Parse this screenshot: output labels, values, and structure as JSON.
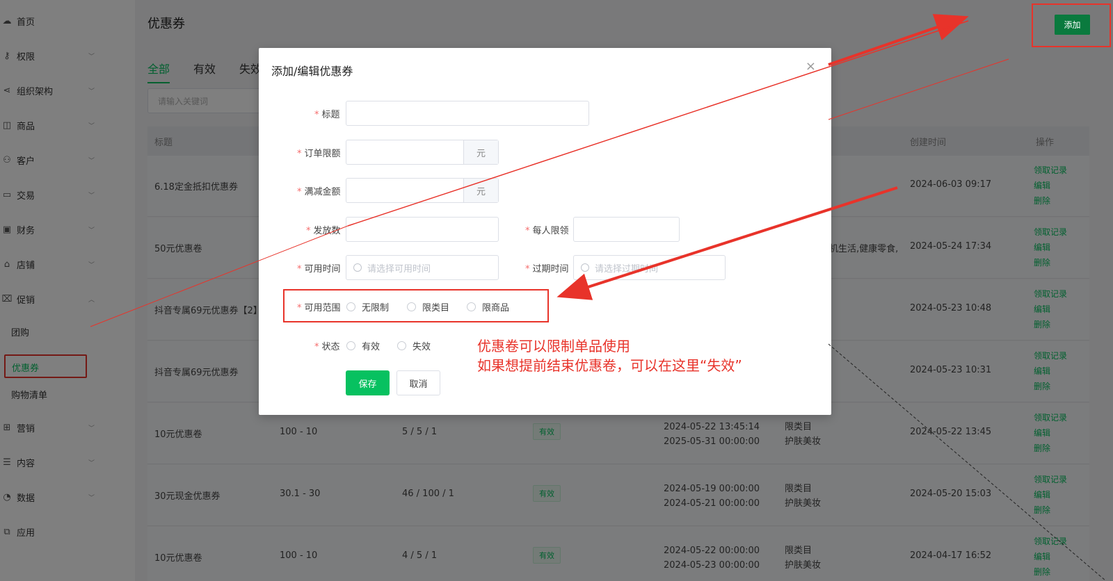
{
  "sidebar": {
    "items": [
      {
        "label": "首页",
        "icon": "cloud-icon",
        "chevron": false
      },
      {
        "label": "权限",
        "icon": "key-icon",
        "chevron": true
      },
      {
        "label": "组织架构",
        "icon": "share-icon",
        "chevron": true
      },
      {
        "label": "商品",
        "icon": "bag-icon",
        "chevron": true
      },
      {
        "label": "客户",
        "icon": "user-icon",
        "chevron": true
      },
      {
        "label": "交易",
        "icon": "folder-icon",
        "chevron": true
      },
      {
        "label": "财务",
        "icon": "wallet-icon",
        "chevron": true
      },
      {
        "label": "店铺",
        "icon": "store-icon",
        "chevron": true
      },
      {
        "label": "促销",
        "icon": "tag-icon",
        "chevron": true
      }
    ],
    "promo_sub": [
      "团购",
      "优惠券",
      "购物清单"
    ],
    "items_bottom": [
      {
        "label": "营销",
        "icon": "gift-icon"
      },
      {
        "label": "内容",
        "icon": "doc-icon"
      },
      {
        "label": "数据",
        "icon": "pie-icon"
      },
      {
        "label": "应用",
        "icon": "app-icon"
      }
    ]
  },
  "page": {
    "title": "优惠券",
    "add_label": "添加",
    "tabs": [
      "全部",
      "有效",
      "失效"
    ],
    "search_placeholder": "请输入关键词"
  },
  "table": {
    "headers": {
      "title": "标题",
      "created": "创建时间",
      "ops": "操作"
    },
    "rows": [
      {
        "title": "6.18定金抵扣优惠券",
        "cond": "",
        "count": "",
        "status": "",
        "time1": "",
        "time2": "",
        "scope1": "",
        "scope2": "",
        "created": "2024-06-03 09:17"
      },
      {
        "title": "50元优惠卷",
        "cond": "",
        "count": "",
        "status": "",
        "time1": "",
        "time2": "",
        "scope1": "机生活,健康零食,",
        "scope2": "",
        "created": "2024-05-24 17:34"
      },
      {
        "title": "抖音专属69元优惠券【2】",
        "cond": "",
        "count": "",
        "status": "",
        "time1": "",
        "time2": "",
        "scope1": "",
        "scope2": "",
        "created": "2024-05-23 10:48"
      },
      {
        "title": "抖音专属69元优惠券",
        "cond": "",
        "count": "",
        "status": "",
        "time1": "",
        "time2": "",
        "scope1": "",
        "scope2": "",
        "created": "2024-05-23 10:31"
      },
      {
        "title": "10元优惠卷",
        "cond": "100 - 10",
        "count": "5 / 5 / 1",
        "status": "有效",
        "time1": "2024-05-22 13:45:14",
        "time2": "2025-05-31 00:00:00",
        "scope1": "限类目",
        "scope2": "护肤美妆",
        "created": "2024-05-22 13:45"
      },
      {
        "title": "30元现金优惠券",
        "cond": "30.1 - 30",
        "count": "46 / 100 / 1",
        "status": "有效",
        "time1": "2024-05-19 00:00:00",
        "time2": "2024-05-21 00:00:00",
        "scope1": "限类目",
        "scope2": "护肤美妆",
        "created": "2024-05-20 15:03"
      },
      {
        "title": "10元优惠卷",
        "cond": "100 - 10",
        "count": "4 / 5 / 1",
        "status": "有效",
        "time1": "2024-05-22 00:00:00",
        "time2": "2024-05-23 00:00:00",
        "scope1": "限类目",
        "scope2": "护肤美妆",
        "created": "2024-04-17 16:52"
      }
    ],
    "ops": {
      "records": "领取记录",
      "edit": "编辑",
      "delete": "删除"
    }
  },
  "modal": {
    "title": "添加/编辑优惠券",
    "close": "×",
    "fields": {
      "title": "标题",
      "order_limit": "订单限额",
      "discount": "满减金额",
      "yuan": "元",
      "issue_count": "发放数",
      "per_user": "每人限领",
      "available_time": "可用时间",
      "available_placeholder": "请选择可用时间",
      "expire_time": "过期时间",
      "expire_placeholder": "请选择过期时间",
      "scope": "可用范围",
      "scope_options": [
        "无限制",
        "限类目",
        "限商品"
      ],
      "status": "状态",
      "status_options": [
        "有效",
        "失效"
      ]
    },
    "save_label": "保存",
    "cancel_label": "取消"
  },
  "annotation": {
    "line1": "优惠卷可以限制单品使用",
    "line2": "如果想提前结束优惠卷，可以在这里“失效”"
  },
  "colors": {
    "accent": "#07c160",
    "annotation": "#e8332a",
    "required": "#f56c6c"
  }
}
